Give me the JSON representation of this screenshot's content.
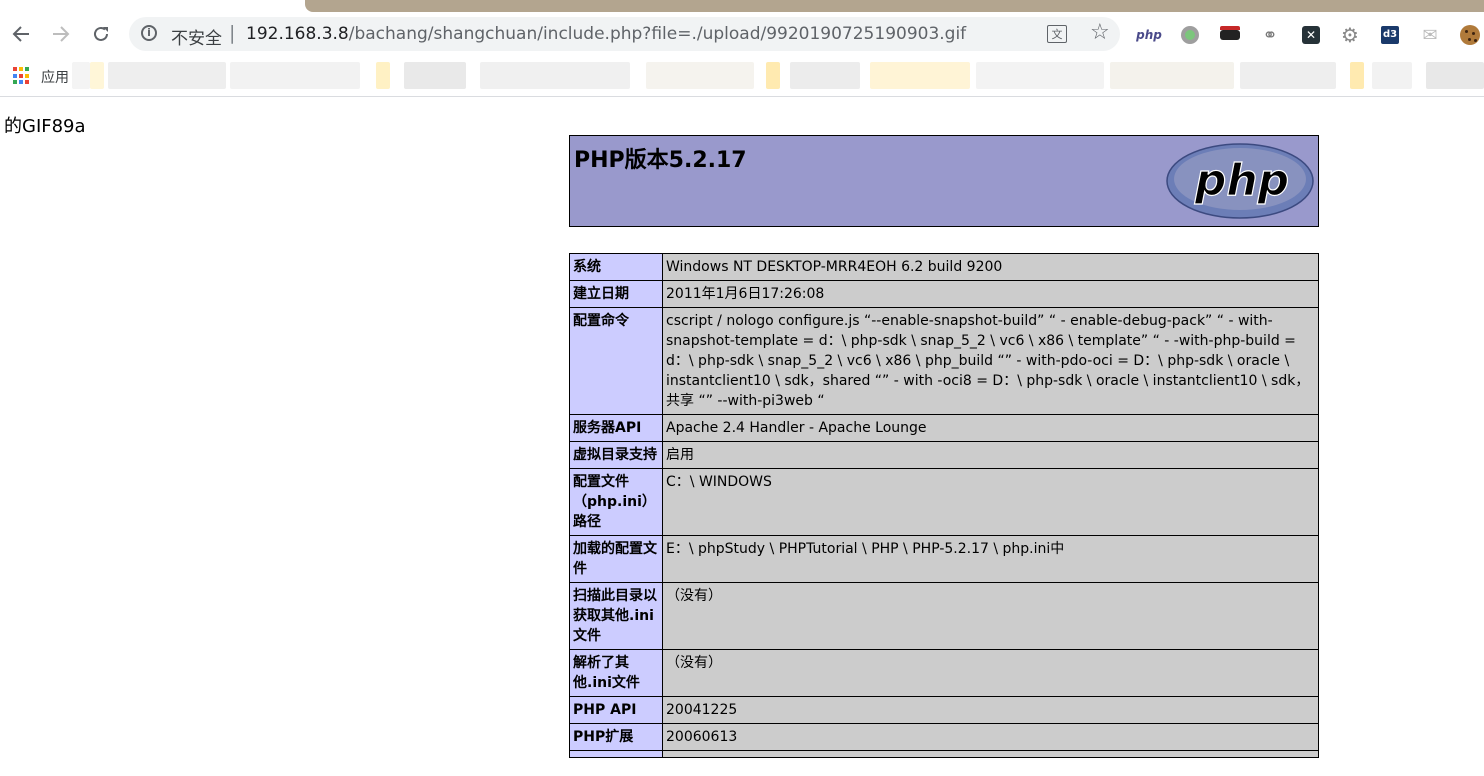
{
  "browser": {
    "security_label": "不安全",
    "url_host": "192.168.3.8",
    "url_path": "/bachang/shangchuan/include.php?file=./upload/9920190725190903.gif",
    "ext_php_label": "php",
    "ext_d3_label": "d3",
    "translate_label": "文"
  },
  "bookmarks": {
    "apps_label": "应用"
  },
  "page": {
    "gif_text": "的GIF89a",
    "php_title": "PHP版本5.2.17",
    "logo_text": "php",
    "rows": [
      {
        "key": "系统",
        "value": "Windows NT DESKTOP-MRR4EOH 6.2 build 9200"
      },
      {
        "key": "建立日期",
        "value": "2011年1月6日17:26:08"
      },
      {
        "key": "配置命令",
        "value": "cscript / nologo configure.js “--enable-snapshot-build” “ - enable-debug-pack” “ - with-snapshot-template = d：\\ php-sdk \\ snap_5_2 \\ vc6 \\ x86 \\ template” “ - -with-php-build = d：\\ php-sdk \\ snap_5_2 \\ vc6 \\ x86 \\ php_build “” - with-pdo-oci = D：\\ php-sdk \\ oracle \\ instantclient10 \\ sdk，shared “” - with -oci8 = D：\\ php-sdk \\ oracle \\ instantclient10 \\ sdk，共享 “” --with-pi3web “"
      },
      {
        "key": "服务器API",
        "value": "Apache 2.4 Handler - Apache Lounge"
      },
      {
        "key": "虚拟目录支持",
        "value": "启用"
      },
      {
        "key": "配置文件（php.ini）路径",
        "value": "C：\\ WINDOWS"
      },
      {
        "key": "加载的配置文件",
        "value": "E：\\ phpStudy \\ PHPTutorial \\ PHP \\ PHP-5.2.17 \\ php.ini中"
      },
      {
        "key": "扫描此目录以获取其他.ini文件",
        "value": "（没有）"
      },
      {
        "key": "解析了其他.ini文件",
        "value": "（没有）"
      },
      {
        "key": "PHP API",
        "value": "20041225"
      },
      {
        "key": "PHP扩展",
        "value": "20060613"
      },
      {
        "key": "",
        "value": ""
      }
    ]
  },
  "colors": {
    "header_bg": "#9999cc",
    "key_bg": "#ccccff",
    "value_bg": "#cccccc",
    "tab_strip": "#b3a58f"
  }
}
